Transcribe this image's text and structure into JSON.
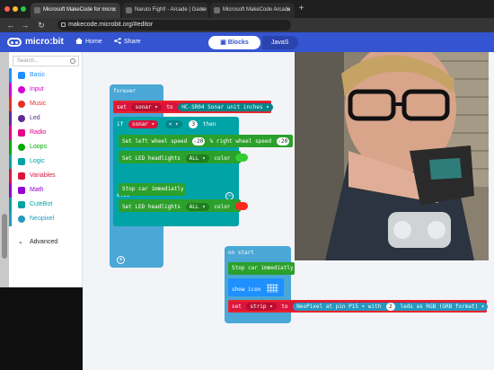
{
  "browser": {
    "tabs": [
      {
        "title": "Microsoft MakeCode for micro:",
        "active": true
      },
      {
        "title": "Naruto Fight! - Arcade | Game",
        "active": false
      },
      {
        "title": "Microsoft MakeCode Arcade",
        "active": false
      }
    ],
    "url": "makecode.microbit.org/#editor"
  },
  "header": {
    "brand": "micro:bit",
    "home_label": "Home",
    "share_label": "Share",
    "blocks_label": "Blocks",
    "js_label": "JavaS"
  },
  "sidebar": {
    "search_placeholder": "Search...",
    "categories": [
      {
        "label": "Basic",
        "color": "#1e90ff"
      },
      {
        "label": "Input",
        "color": "#d400d4"
      },
      {
        "label": "Music",
        "color": "#e63022"
      },
      {
        "label": "Led",
        "color": "#5c2d91"
      },
      {
        "label": "Radio",
        "color": "#e3008c"
      },
      {
        "label": "Loops",
        "color": "#00aa00"
      },
      {
        "label": "Logic",
        "color": "#00a4a6"
      },
      {
        "label": "Variables",
        "color": "#dc143c"
      },
      {
        "label": "Math",
        "color": "#9400d3"
      },
      {
        "label": "CuteBot",
        "color": "#00a3a3"
      },
      {
        "label": "Neopixel",
        "color": "#2699bf"
      }
    ],
    "advanced_label": "Advanced"
  },
  "workspace": {
    "forever": {
      "label": "forever",
      "set_kw": "set",
      "var": "sonar",
      "to_kw": "to",
      "sonar_block": "HC-SR04 Sonar unit inches",
      "if_kw": "if",
      "lt": "<",
      "threshold": "3",
      "then_kw": "then",
      "wheel_pre": "Set left wheel speed",
      "wheel_left": "-20",
      "wheel_mid": "% right wheel speed",
      "wheel_right": "-20",
      "wheel_post": "%",
      "headlights_pre": "Set LED headlights",
      "headlights_opt": "ALL",
      "color_kw": "color",
      "color_then": "#33cc33",
      "else_kw": "else",
      "stop_car": "Stop car immediatly",
      "color_else": "#ff2a1f"
    },
    "on_start": {
      "label": "on start",
      "stop_car": "Stop car immediatly",
      "show_icon": "show icon",
      "set_kw": "set",
      "var": "strip",
      "to_kw": "to",
      "neo_pre": "NeoPixel at pin",
      "pin": "P15",
      "with_kw": "with",
      "leds_count": "2",
      "leds_kw": "leds as",
      "mode": "RGB (GRB format)"
    }
  }
}
